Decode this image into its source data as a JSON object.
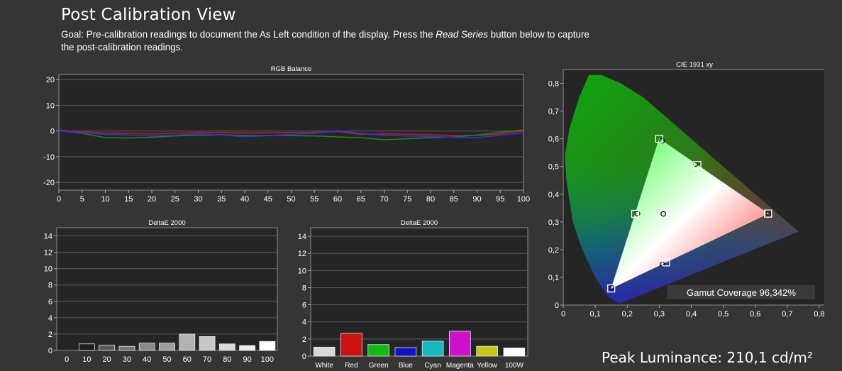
{
  "header": {
    "title": "Post Calibration View",
    "goal_prefix": "Goal: Pre-calibration readings to document the As Left condition of the display. Press the ",
    "goal_em": "Read Series",
    "goal_suffix": " button below to capture the post-calibration readings."
  },
  "peak_luminance": "Peak Luminance: 210,1 cd/m²",
  "colors": {
    "red": "#d01515",
    "green": "#1a8a1a",
    "blue": "#2233ee"
  },
  "chart_data": [
    {
      "id": "rgb",
      "type": "line",
      "title": "RGB Balance",
      "x": [
        0,
        5,
        10,
        15,
        20,
        25,
        30,
        35,
        40,
        45,
        50,
        55,
        60,
        65,
        70,
        75,
        80,
        85,
        90,
        95,
        100
      ],
      "xticks": [
        "0",
        "5",
        "10",
        "15",
        "20",
        "25",
        "30",
        "35",
        "40",
        "45",
        "50",
        "55",
        "60",
        "65",
        "70",
        "75",
        "80",
        "85",
        "90",
        "95",
        "100"
      ],
      "yticks": [
        "20",
        "10",
        "0",
        "-10",
        "-20"
      ],
      "ylim": [
        -23,
        22
      ],
      "grid": true,
      "series": [
        {
          "color": "#d01515",
          "values": [
            0.4,
            -0.3,
            -0.8,
            -1.0,
            -1.1,
            -0.9,
            -0.5,
            -0.6,
            -0.8,
            -0.7,
            -0.6,
            -0.5,
            -0.2,
            -1.3,
            -1.1,
            -1.2,
            -1.5,
            -1.8,
            -1.7,
            -1.2,
            0.0
          ]
        },
        {
          "color": "#1a8a1a",
          "values": [
            0.2,
            -0.9,
            -2.6,
            -2.7,
            -2.4,
            -1.9,
            -1.6,
            -1.4,
            -1.8,
            -1.7,
            -1.8,
            -1.9,
            -2.3,
            -2.6,
            -3.4,
            -3.0,
            -2.6,
            -2.3,
            -1.6,
            -0.5,
            0.5
          ]
        },
        {
          "color": "#2233ee",
          "values": [
            0.0,
            -0.6,
            -1.3,
            -1.6,
            -1.9,
            -1.6,
            -1.1,
            -1.5,
            -2.2,
            -1.8,
            -1.3,
            -0.9,
            0.1,
            -0.9,
            -1.7,
            -1.9,
            -2.1,
            -2.4,
            -2.6,
            -1.6,
            -0.9
          ]
        }
      ]
    },
    {
      "id": "grayscale",
      "type": "bar",
      "title": "DeltaE 2000",
      "categories": [
        "0",
        "10",
        "20",
        "30",
        "40",
        "50",
        "60",
        "70",
        "80",
        "90",
        "100"
      ],
      "values": [
        0.0,
        0.8,
        0.65,
        0.5,
        0.9,
        0.9,
        2.0,
        1.7,
        0.8,
        0.6,
        1.1
      ],
      "colors": [
        "#d8d8d8",
        "#1e1e1e",
        "#585858",
        "#727272",
        "#8a8a8a",
        "#9e9e9e",
        "#b2b2b2",
        "#c6c6c6",
        "#dadada",
        "#ececec",
        "#ffffff"
      ],
      "yticks": [
        "14",
        "12",
        "10",
        "8",
        "6",
        "4",
        "2",
        "0"
      ],
      "ylim": [
        0,
        15
      ],
      "grid": true
    },
    {
      "id": "colors",
      "type": "bar",
      "title": "DeltaE 2000",
      "categories": [
        "White",
        "Red",
        "Green",
        "Blue",
        "Cyan",
        "Magenta",
        "Yellow",
        "100W"
      ],
      "values": [
        1.05,
        2.65,
        1.35,
        1.0,
        1.75,
        2.9,
        1.15,
        0.95
      ],
      "colors": [
        "#d8d8d8",
        "#cc1111",
        "#11bb11",
        "#1111cc",
        "#11bbbb",
        "#cc11cc",
        "#c8c811",
        "#ffffff"
      ],
      "yticks": [
        "14",
        "12",
        "10",
        "8",
        "6",
        "4",
        "2",
        "0"
      ],
      "ylim": [
        0,
        15
      ],
      "grid": true
    },
    {
      "id": "cie",
      "type": "scatter",
      "title": "CIE 1931 xy",
      "xticks": [
        "0",
        "0,1",
        "0,2",
        "0,3",
        "0,4",
        "0,5",
        "0,6",
        "0,7",
        "0,8"
      ],
      "yticks": [
        "0,8",
        "0,7",
        "0,6",
        "0,5",
        "0,4",
        "0,3",
        "0,2",
        "0,1",
        "0"
      ],
      "xlim": [
        0,
        0.82
      ],
      "ylim": [
        0,
        0.85
      ],
      "target_gamut": [
        [
          0.64,
          0.33
        ],
        [
          0.3,
          0.6
        ],
        [
          0.15,
          0.06
        ]
      ],
      "targets": [
        [
          0.64,
          0.33
        ],
        [
          0.3,
          0.6
        ],
        [
          0.15,
          0.06
        ],
        [
          0.225,
          0.329
        ],
        [
          0.321,
          0.154
        ],
        [
          0.419,
          0.505
        ],
        [
          0.3127,
          0.329
        ]
      ],
      "measured": [
        [
          0.641,
          0.331
        ],
        [
          0.309,
          0.593
        ],
        [
          0.152,
          0.062
        ],
        [
          0.232,
          0.33
        ],
        [
          0.31,
          0.146
        ],
        [
          0.414,
          0.509
        ],
        [
          0.3127,
          0.329
        ]
      ],
      "gamut_coverage": "Gamut Coverage 96,342%"
    }
  ]
}
